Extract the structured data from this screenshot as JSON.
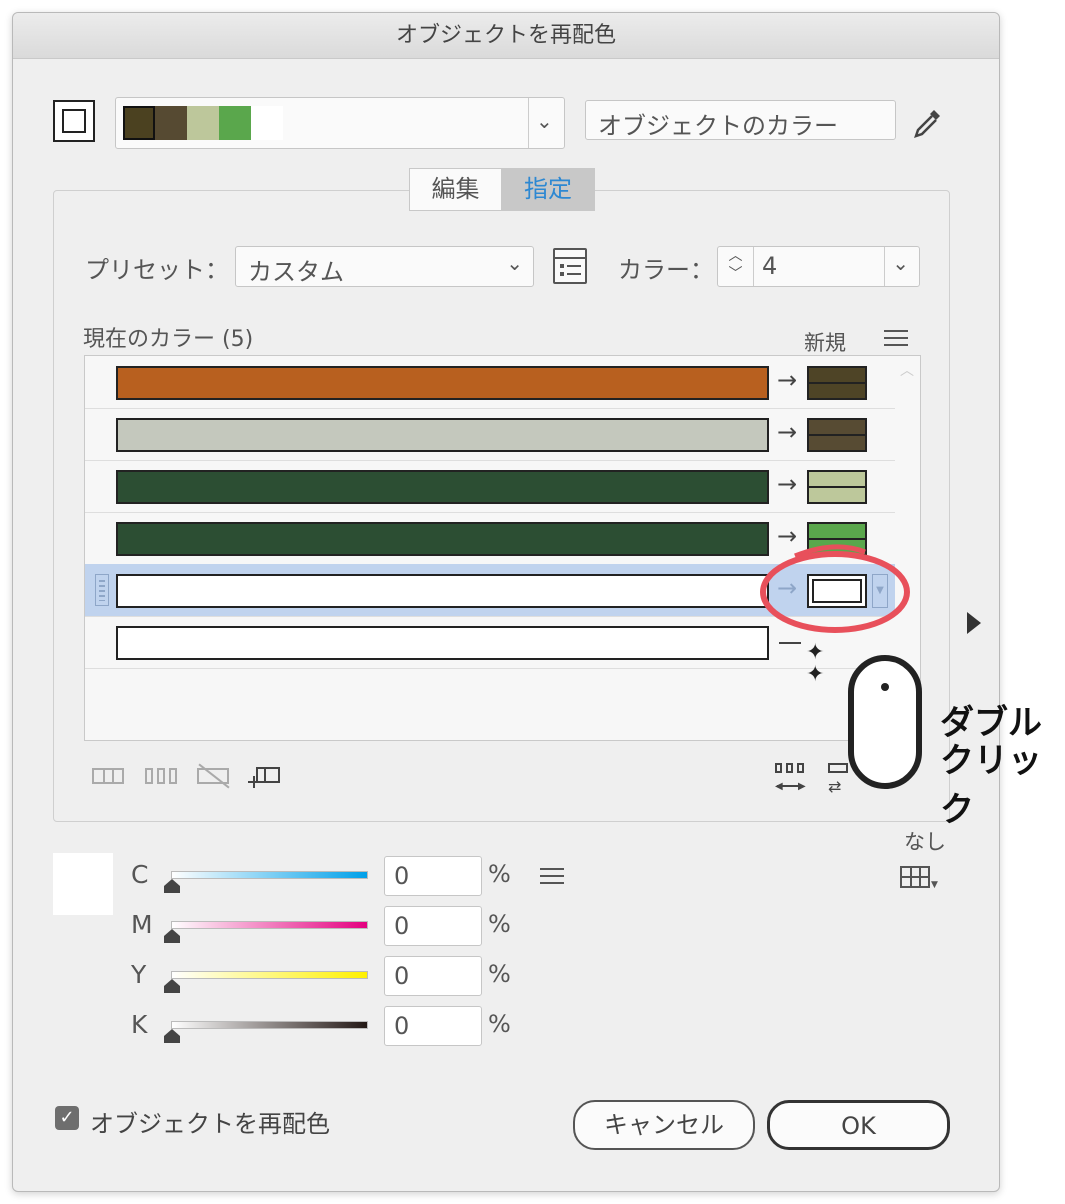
{
  "window": {
    "title": "オブジェクトを再配色"
  },
  "top": {
    "group_colors": [
      "#4b4120",
      "#564a32",
      "#bdc79b",
      "#5aa74c",
      "#ffffff"
    ],
    "source_field": "オブジェクトのカラー"
  },
  "tabs": [
    {
      "label": "編集"
    },
    {
      "label": "指定"
    }
  ],
  "preset": {
    "label": "プリセット：",
    "value": "カスタム"
  },
  "color_count": {
    "label": "カラー：",
    "value": "4"
  },
  "current_colors": {
    "label": "現在のカラー (5)",
    "new_label": "新規"
  },
  "rows": [
    {
      "current": "#b8601f",
      "new": "#4e4426"
    },
    {
      "current": "#c4c8bd",
      "new": "#574b33"
    },
    {
      "current": "#2c4e33",
      "new": "#bdc89b"
    },
    {
      "current": "#2c4e33",
      "new": "#5aa74c"
    },
    {
      "current": "#ffffff",
      "new": "#ffffff",
      "selected": true
    },
    {
      "current": "#ffffff",
      "new": null
    }
  ],
  "annotation": {
    "line1": "ダブル",
    "line2": "クリック",
    "circle_color": "#e8505b"
  },
  "none_label": "なし",
  "cmyk": [
    {
      "label": "C",
      "value": "0",
      "unit": "%",
      "gradient_end": "#00a0e9"
    },
    {
      "label": "M",
      "value": "0",
      "unit": "%",
      "gradient_end": "#e4007f"
    },
    {
      "label": "Y",
      "value": "0",
      "unit": "%",
      "gradient_end": "#fff100"
    },
    {
      "label": "K",
      "value": "0",
      "unit": "%",
      "gradient_end": "#231815"
    }
  ],
  "footer": {
    "recolor_label": "オブジェクトを再配色",
    "cancel_label": "キャンセル",
    "ok_label": "OK"
  }
}
